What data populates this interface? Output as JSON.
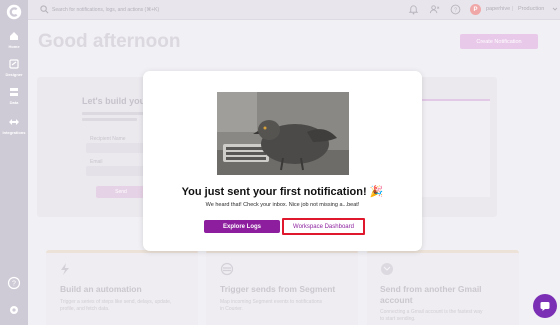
{
  "sidebar": {
    "items": [
      {
        "label": "Home",
        "icon": "home-icon"
      },
      {
        "label": "Designer",
        "icon": "designer-icon"
      },
      {
        "label": "Data",
        "icon": "data-icon"
      },
      {
        "label": "Integrations",
        "icon": "integrations-icon"
      }
    ],
    "bottom_icons": [
      "help-icon",
      "settings-icon"
    ]
  },
  "topbar": {
    "search_placeholder": "Search for notifications, logs, and actions (⌘+K)",
    "avatar_initial": "P",
    "user_name": "paperhive",
    "separator": "|",
    "environment": "Production",
    "icons": [
      "bell-icon",
      "people-icon",
      "help-circle-icon"
    ]
  },
  "page": {
    "greeting": "Good afternoon",
    "create_button": "Create Notification",
    "card_title": "Let's build you",
    "send_button": "Send",
    "field_labels": [
      "Recipient Name",
      "Email"
    ]
  },
  "features": [
    {
      "title": "Build an automation",
      "desc_line1": "Trigger a series of steps like send, delays, update,",
      "desc_line2": "profile, and fetch data."
    },
    {
      "title": "Trigger sends from Segment",
      "desc_line1": "Map incoming Segment events to notifications",
      "desc_line2": "in Courier."
    },
    {
      "title": "Send from another Gmail",
      "title_line2": "account",
      "desc_line1": "Connecting a Gmail account is the fastest way",
      "desc_line2": "to start sending."
    }
  ],
  "modal": {
    "title": "You just sent your first notification! 🎉",
    "subtitle": "We heard that! Check your inbox. Nice job not missing a...beat!",
    "explore_button": "Explore Logs",
    "workspace_button": "Workspace Dashboard"
  },
  "colors": {
    "sidebar": "#cfcbd6",
    "accent": "#8d1f9e",
    "highlight_border": "#e0182d",
    "chat": "#7b2fb5"
  }
}
